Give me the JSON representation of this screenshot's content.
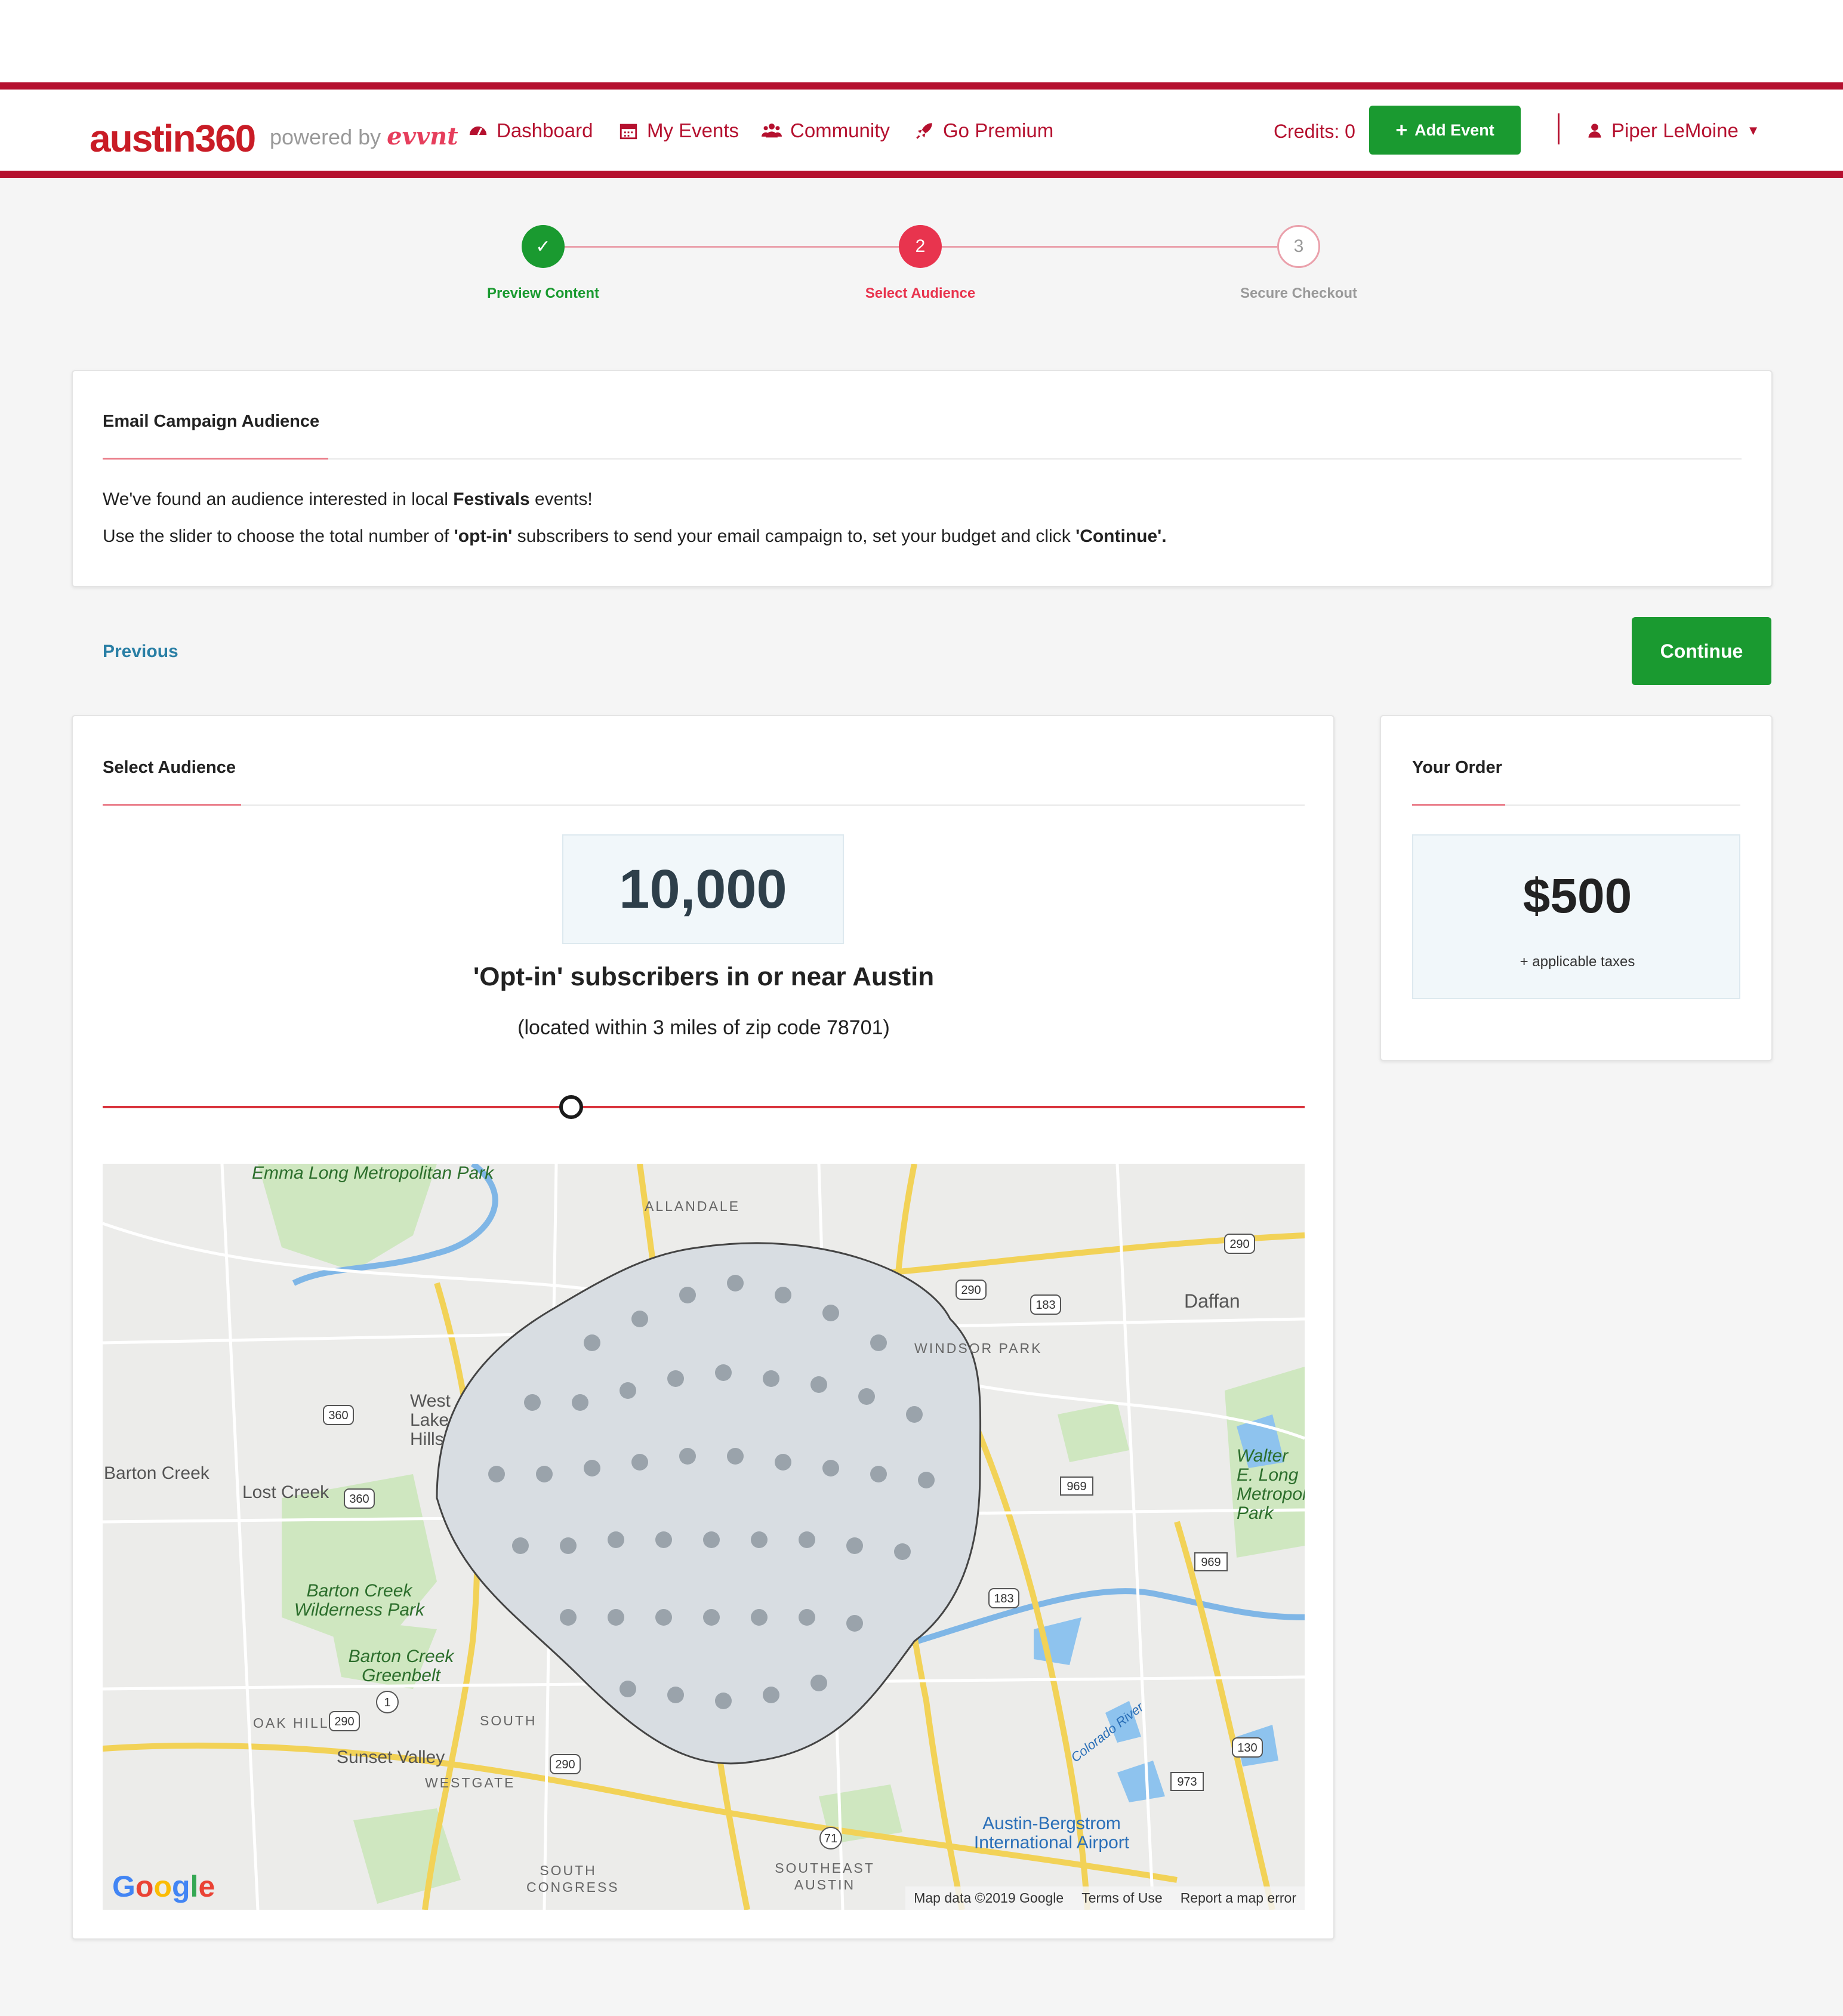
{
  "header": {
    "logo": "austin360",
    "powered_by": "powered by",
    "powered_brand": "evvnt",
    "nav": [
      {
        "label": "Dashboard",
        "icon": "dashboard-icon"
      },
      {
        "label": "My Events",
        "icon": "calendar-icon"
      },
      {
        "label": "Community",
        "icon": "users-icon"
      },
      {
        "label": "Go Premium",
        "icon": "rocket-icon"
      }
    ],
    "credits": "Credits: 0",
    "add_event": "Add Event",
    "user_name": "Piper LeMoine"
  },
  "stepper": {
    "steps": [
      {
        "label": "Preview Content",
        "marker": "✓",
        "state": "done"
      },
      {
        "label": "Select Audience",
        "marker": "2",
        "state": "active"
      },
      {
        "label": "Secure Checkout",
        "marker": "3",
        "state": "pending"
      }
    ]
  },
  "campaign": {
    "title": "Email Campaign Audience",
    "line1_pre": "We've found an audience interested in local ",
    "line1_bold": "Festivals",
    "line1_post": " events!",
    "line2_pre": "Use the slider to choose the total number of ",
    "line2_bold1": "'opt-in'",
    "line2_mid": " subscribers to send your email campaign to, set your budget and click ",
    "line2_bold2": "'Continue'."
  },
  "actions": {
    "previous": "Previous",
    "continue": "Continue"
  },
  "audience": {
    "title": "Select Audience",
    "count": "10,000",
    "headline": "'Opt-in' subscribers in or near Austin",
    "subline": "(located within 3 miles of zip code 78701)",
    "slider_value_fraction": 0.39
  },
  "map": {
    "labels": [
      "Emma Long Metropolitan Park",
      "ALLANDALE",
      "Daffan",
      "WINDSOR PARK",
      "West Lake Hills",
      "Barton Creek",
      "Lost Creek",
      "Walter E. Long Metropolitan Park",
      "Barton Creek Wilderness Park",
      "Barton Creek Greenbelt",
      "OAK HILL",
      "Sunset Valley",
      "WESTGATE",
      "SOUTH",
      "SOUTH CONGRESS",
      "SOUTHEAST AUSTIN",
      "Austin-Bergstrom International Airport",
      "Colorado River"
    ],
    "shields": [
      "290",
      "183",
      "360",
      "969",
      "1",
      "71",
      "130",
      "973"
    ],
    "attribution": "Map data ©2019 Google",
    "terms": "Terms of Use",
    "report": "Report a map error",
    "google": "Google"
  },
  "order": {
    "title": "Your Order",
    "price": "$500",
    "taxes": "+ applicable taxes"
  },
  "colors": {
    "brand_red": "#b5112f",
    "green": "#1a9a30",
    "active_step": "#e8344e",
    "link_blue": "#2a7fa5"
  }
}
